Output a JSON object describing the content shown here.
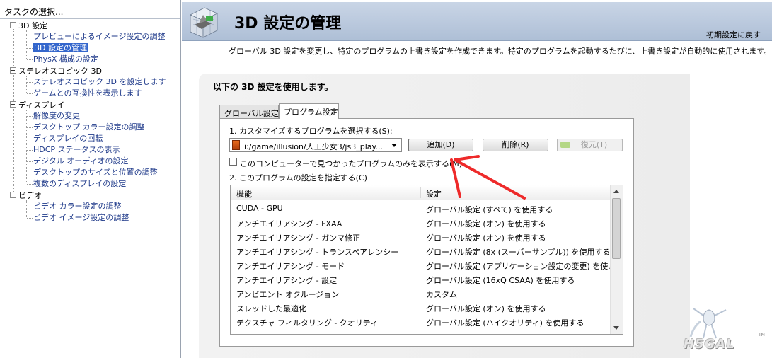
{
  "task_pane": {
    "title": "タスクの選択...",
    "tree": [
      {
        "label": "3D 設定",
        "children": [
          {
            "label": "プレビューによるイメージ設定の調整"
          },
          {
            "label": "3D 設定の管理",
            "selected": true
          },
          {
            "label": "PhysX 構成の設定"
          }
        ]
      },
      {
        "label": "ステレオスコピック 3D",
        "children": [
          {
            "label": "ステレオスコピック 3D を設定します"
          },
          {
            "label": "ゲームとの互換性を表示します"
          }
        ]
      },
      {
        "label": "ディスプレイ",
        "children": [
          {
            "label": "解像度の変更"
          },
          {
            "label": "デスクトップ カラー設定の調整"
          },
          {
            "label": "ディスプレイの回転"
          },
          {
            "label": "HDCP ステータスの表示"
          },
          {
            "label": "デジタル オーディオの設定"
          },
          {
            "label": "デスクトップのサイズと位置の調整"
          },
          {
            "label": "複数のディスプレイの設定"
          }
        ]
      },
      {
        "label": "ビデオ",
        "children": [
          {
            "label": "ビデオ カラー設定の調整"
          },
          {
            "label": "ビデオ イメージ設定の調整"
          }
        ]
      }
    ]
  },
  "header": {
    "title": "3D 設定の管理",
    "restore_link": "初期設定に戻す",
    "description": "グローバル 3D 設定を変更し、特定のプログラムの上書き設定を作成できます。特定のプログラムを起動するたびに、上書き設定が自動的に使用されます。"
  },
  "main": {
    "group_label": "以下の 3D 設定を使用します。",
    "tabs": [
      {
        "label": "グローバル設定",
        "active": false
      },
      {
        "label": "プログラム設定",
        "active": true
      }
    ],
    "step1_label": "1. カスタマイズするプログラムを選択する(S):",
    "program_select_value": "i:/game/illusion/人工少女3/js3_play...",
    "buttons": {
      "add": "追加(D)",
      "remove": "削除(R)",
      "restore": "復元(T)"
    },
    "checkbox_label": "このコンピューターで見つかったプログラムのみを表示する(M)",
    "step2_label": "2. このプログラムの設定を指定する(C)",
    "table": {
      "headers": [
        "機能",
        "設定"
      ],
      "rows": [
        [
          "CUDA - GPU",
          "グローバル設定 (すべて) を使用する"
        ],
        [
          "アンチエイリアシング - FXAA",
          "グローバル設定 (オン) を使用する"
        ],
        [
          "アンチエイリアシング - ガンマ修正",
          "グローバル設定 (オン) を使用する"
        ],
        [
          "アンチエイリアシング - トランスペアレンシー",
          "グローバル設定 (8x (スーパーサンプル)) を使用する"
        ],
        [
          "アンチエイリアシング - モード",
          "グローバル設定 (アプリケーション設定の変更) を使..."
        ],
        [
          "アンチエイリアシング - 設定",
          "グローバル設定 (16xQ CSAA) を使用する"
        ],
        [
          "アンビエント オクルージョン",
          "カスタム"
        ],
        [
          "スレッドした最適化",
          "グローバル設定 (オン) を使用する"
        ],
        [
          "テクスチャ フィルタリング - クオリティ",
          "グローバル設定 (ハイクオリティ) を使用する"
        ]
      ]
    }
  },
  "annotation": {
    "color": "#ee2a2a"
  },
  "watermark": {
    "text": "H5GAL",
    "tm": "TM"
  }
}
